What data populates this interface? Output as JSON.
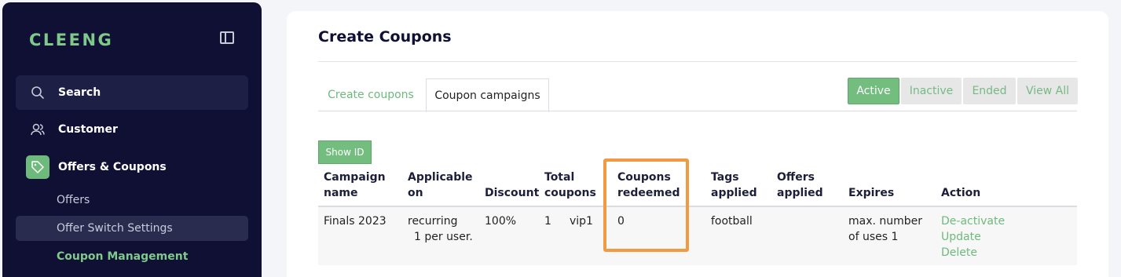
{
  "sidebar": {
    "logo": "CLEENG",
    "nav": {
      "search": "Search",
      "customer": "Customer",
      "offers_coupons": "Offers & Coupons"
    },
    "sub": {
      "offers": "Offers",
      "offer_switch": "Offer Switch Settings",
      "coupon_management": "Coupon Management"
    }
  },
  "main": {
    "title": "Create Coupons",
    "tabs": {
      "create": "Create coupons",
      "campaigns": "Coupon campaigns"
    },
    "filters": {
      "active": "Active",
      "inactive": "Inactive",
      "ended": "Ended",
      "all": "View All"
    },
    "show_id": "Show ID",
    "table": {
      "headers": {
        "campaign_1": "Campaign",
        "campaign_2": "name",
        "applicable_1": "Applicable",
        "applicable_2": "on",
        "discount": "Discount",
        "total_1": "Total",
        "total_2": "coupons",
        "redeemed_1": "Coupons",
        "redeemed_2": "redeemed",
        "tags_1": "Tags",
        "tags_2": "applied",
        "offers_1": "Offers",
        "offers_2": "applied",
        "expires": "Expires",
        "action": "Action"
      },
      "row": {
        "name": "Finals 2023",
        "applicable_1": "recurring",
        "applicable_2": "1 per user.",
        "discount": "100%",
        "total": "1",
        "code": "vip1",
        "redeemed": "0",
        "tags": "football",
        "expires_1": "max. number",
        "expires_2": "of uses 1",
        "actions": {
          "deactivate": "De-activate",
          "update": "Update",
          "delete": "Delete"
        }
      }
    }
  },
  "colors": {
    "accent": "#6dba7c",
    "sidebar_bg": "#0f1033",
    "highlight": "#f29a42"
  }
}
